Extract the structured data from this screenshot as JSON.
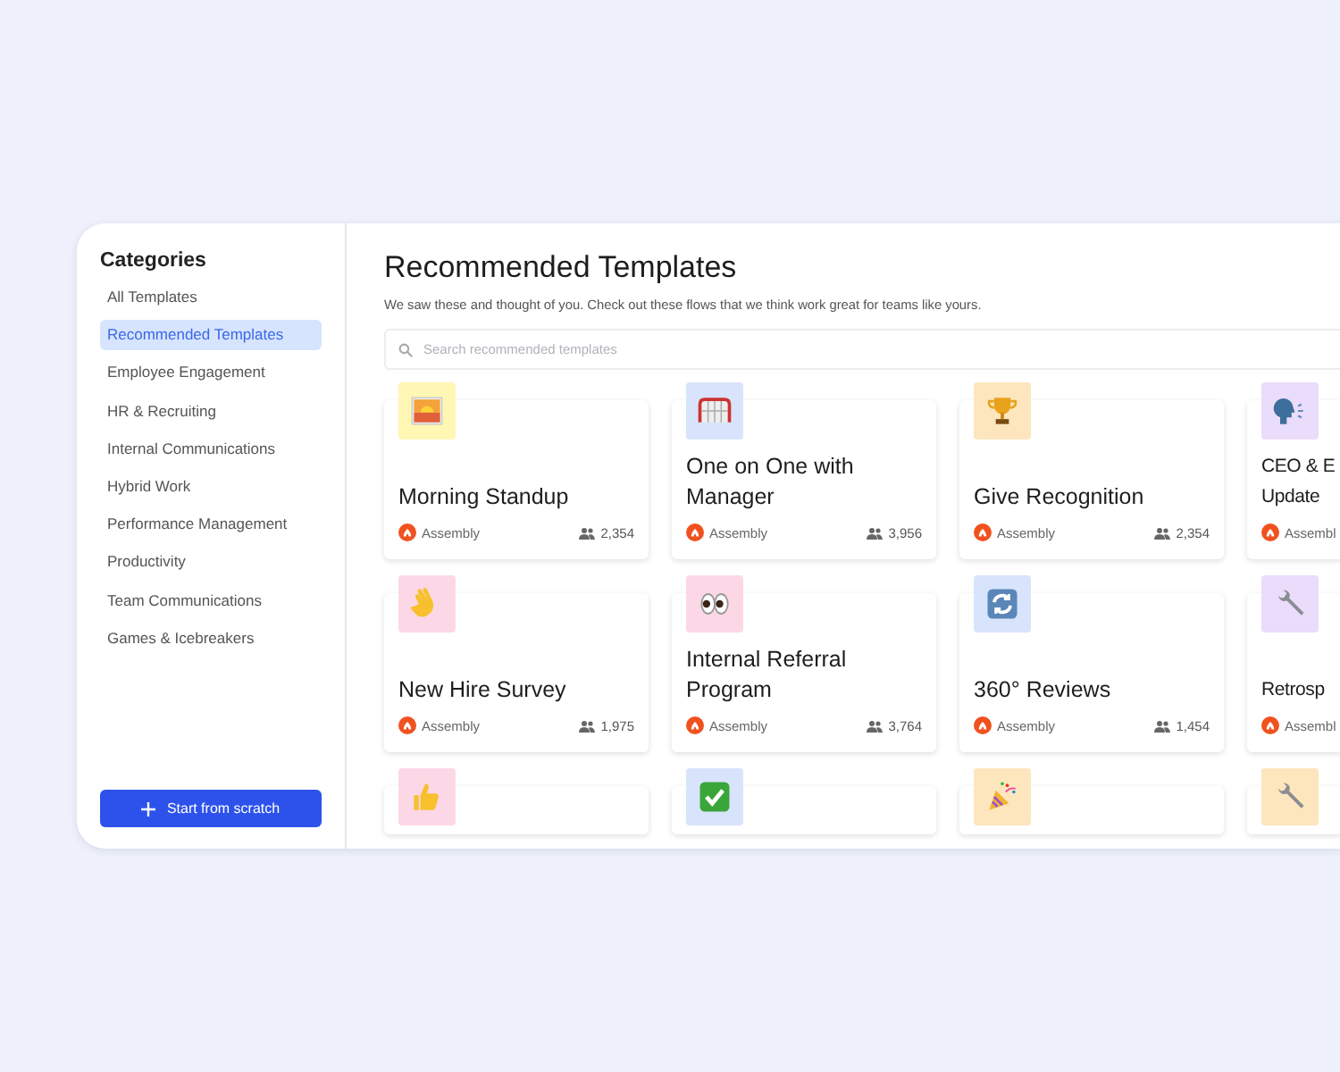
{
  "sidebar": {
    "heading": "Categories",
    "items": [
      {
        "label": "All Templates",
        "selected": false
      },
      {
        "label": "Recommended Templates",
        "selected": true
      },
      {
        "label": "Employee Engagement",
        "selected": false
      },
      {
        "label": "HR & Recruiting",
        "selected": false
      },
      {
        "label": "Internal Communications",
        "selected": false
      },
      {
        "label": "Hybrid Work",
        "selected": false
      },
      {
        "label": "Performance Management",
        "selected": false
      },
      {
        "label": "Productivity",
        "selected": false
      },
      {
        "label": "Team Communications",
        "selected": false
      },
      {
        "label": "Games & Icebreakers",
        "selected": false
      }
    ],
    "button": {
      "label": "Start from scratch"
    }
  },
  "main": {
    "title": "Recommended Templates",
    "subtitle": "We saw these and thought of you. Check out these flows that we think work great for teams like yours.",
    "search": {
      "placeholder": "Search recommended templates"
    },
    "cards": [
      {
        "title": "Morning Standup",
        "author": "Assembly",
        "uses": "2,354",
        "color": "#fff7b3"
      },
      {
        "title": "One on One with Manager",
        "author": "Assembly",
        "uses": "3,956",
        "color": "#d8e4fb"
      },
      {
        "title": "Give Recognition",
        "author": "Assembly",
        "uses": "2,354",
        "color": "#fde6bd"
      },
      {
        "title": "CEO & E\nUpdate",
        "author": "Assembl",
        "color": "#eadcfb"
      },
      {
        "title": "New Hire Survey",
        "author": "Assembly",
        "uses": "1,975",
        "color": "#fcd8e6"
      },
      {
        "title": "Internal Referral Program",
        "author": "Assembly",
        "uses": "3,764",
        "color": "#fcd8e6"
      },
      {
        "title": "360° Reviews",
        "author": "Assembly",
        "uses": "1,454",
        "color": "#d8e4fb"
      },
      {
        "title": "Retrosp",
        "author": "Assembl",
        "color": "#eadcfb"
      },
      {
        "color": "#fcd8e6"
      },
      {
        "color": "#d8e4fb"
      },
      {
        "color": "#fde6bd"
      },
      {
        "color": "#fde6bd"
      }
    ]
  }
}
